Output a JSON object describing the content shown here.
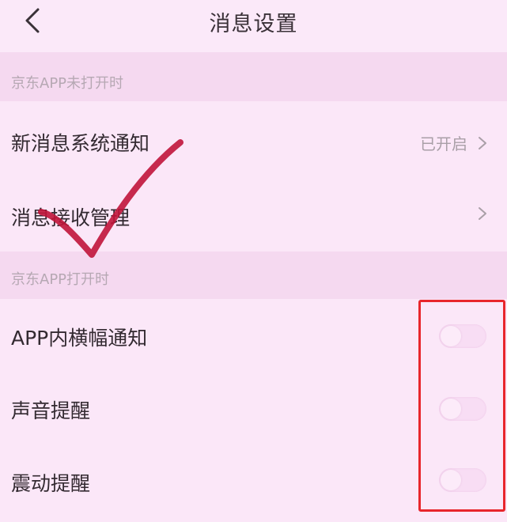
{
  "header": {
    "title": "消息设置",
    "back_icon": "chevron-left-icon"
  },
  "sections": [
    {
      "header": "京东APP未打开时",
      "rows": [
        {
          "label": "新消息系统通知",
          "value": "已开启",
          "type": "link"
        },
        {
          "label": "消息接收管理",
          "value": "",
          "type": "link"
        }
      ]
    },
    {
      "header": "京东APP打开时",
      "rows": [
        {
          "label": "APP内横幅通知",
          "type": "toggle",
          "on": false
        },
        {
          "label": "声音提醒",
          "type": "toggle",
          "on": false
        },
        {
          "label": "震动提醒",
          "type": "toggle",
          "on": false
        }
      ]
    }
  ],
  "colors": {
    "background": "#fbe8f8",
    "section_header": "#f5d9f0",
    "annotation_red": "#e8262c",
    "checkmark_red": "#c0143a"
  }
}
